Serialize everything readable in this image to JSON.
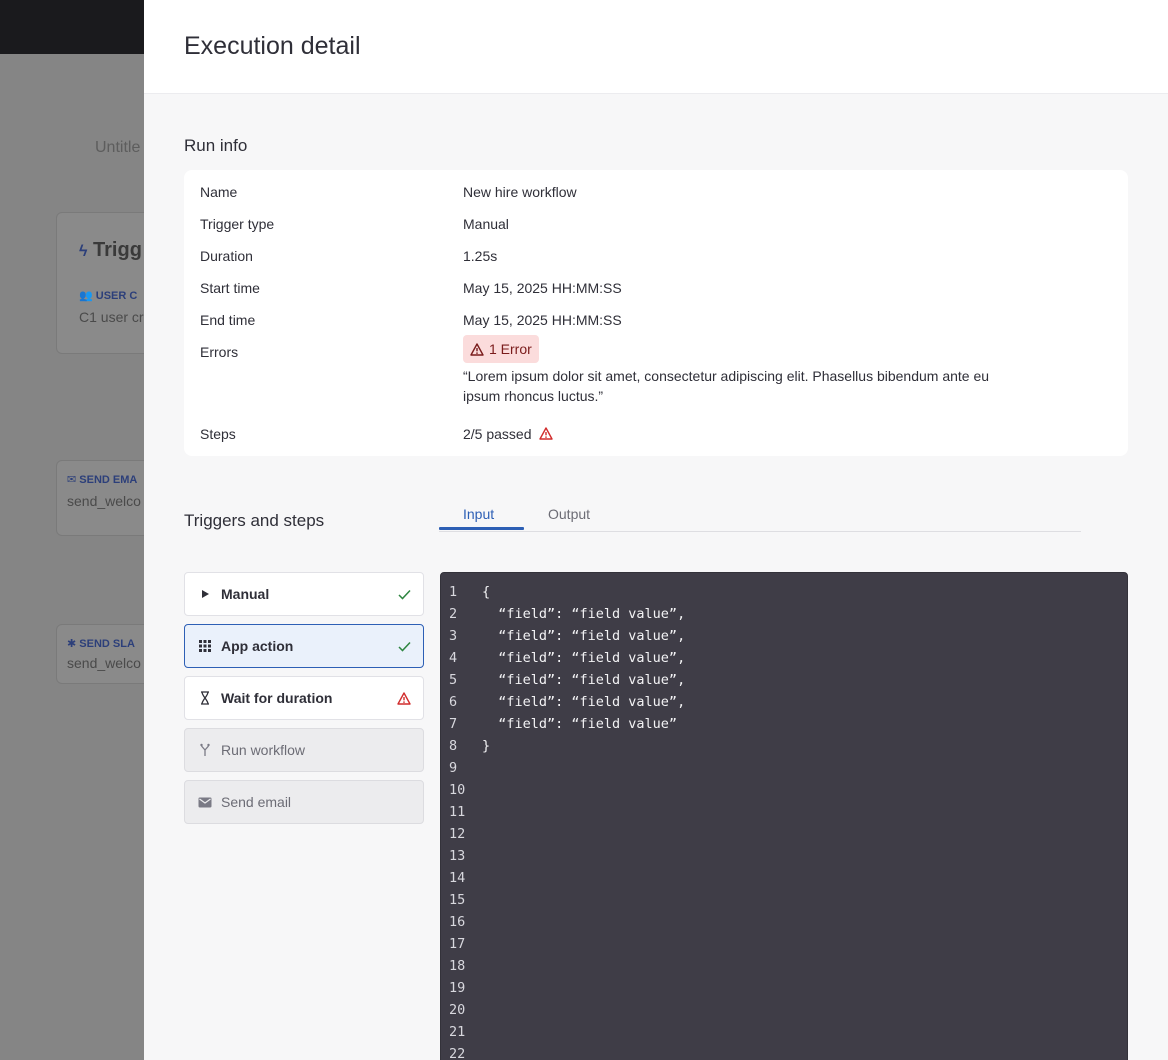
{
  "background": {
    "tab_label": "Untitle",
    "trigger_title": "Trigg",
    "card1": {
      "type": "USER C",
      "value": "C1 user cr"
    },
    "card2": {
      "type": "SEND EMA",
      "value": "send_welco"
    },
    "card3": {
      "type": "SEND SLA",
      "value": "send_welco"
    }
  },
  "drawer": {
    "title": "Execution detail"
  },
  "run_info": {
    "title": "Run info",
    "rows": [
      {
        "label": "Name",
        "value": "New hire workflow"
      },
      {
        "label": "Trigger type",
        "value": "Manual"
      },
      {
        "label": "Duration",
        "value": "1.25s"
      },
      {
        "label": "Start time",
        "value": "May 15, 2025 HH:MM:SS"
      },
      {
        "label": "End time",
        "value": "May 15, 2025 HH:MM:SS"
      }
    ],
    "errors": {
      "label": "Errors",
      "badge": "1 Error",
      "message": "“Lorem ipsum dolor sit amet, consectetur adipiscing elit. Phasellus bibendum ante eu ipsum rhoncus luctus.”"
    },
    "steps": {
      "label": "Steps",
      "value": "2/5 passed"
    }
  },
  "triggers_and_steps": {
    "title": "Triggers and steps",
    "items": [
      {
        "label": "Manual",
        "icon": "play-icon",
        "status": "passed"
      },
      {
        "label": "App action",
        "icon": "grid-icon",
        "status": "passed",
        "selected": true
      },
      {
        "label": "Wait for duration",
        "icon": "hourglass-icon",
        "status": "error"
      },
      {
        "label": "Run workflow",
        "icon": "branch-icon",
        "status": "not-run"
      },
      {
        "label": "Send email",
        "icon": "mail-icon",
        "status": "not-run"
      }
    ]
  },
  "tabs": {
    "input": "Input",
    "output": "Output",
    "active": "Input"
  },
  "code": {
    "lines": [
      "{",
      "  “field”: “field value”,",
      "  “field”: “field value”,",
      "  “field”: “field value”,",
      "  “field”: “field value”,",
      "  “field”: “field value”,",
      "  “field”: “field value”",
      "}",
      "",
      "",
      "",
      "",
      "",
      "",
      "",
      "",
      "",
      "",
      "",
      "",
      "",
      ""
    ]
  },
  "colors": {
    "accent": "#2d5fb5",
    "success": "#2e8540",
    "error": "#d12c2c",
    "code_bg": "#3f3d47"
  }
}
